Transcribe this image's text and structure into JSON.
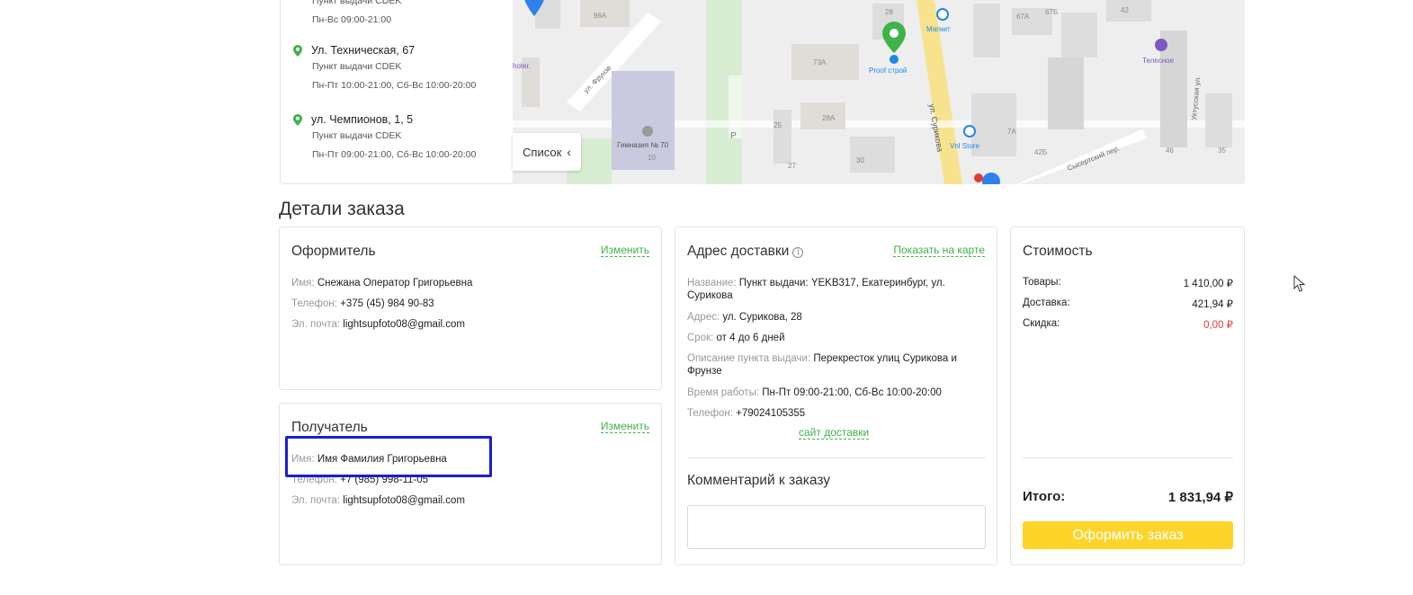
{
  "pickup_points": [
    {
      "address": "",
      "type": "Пункт выдачи CDEK",
      "hours": "Пн-Вс 09:00-21:00"
    },
    {
      "address": "Ул. Техническая, 67",
      "type": "Пункт выдачи CDEK",
      "hours": "Пн-Пт 10:00-21:00, Сб-Вс 10:00-20:00"
    },
    {
      "address": "ул. Чемпионов, 1, 5",
      "type": "Пункт выдачи CDEK",
      "hours": "Пн-Пт 09:00-21:00, Сб-Вс 10:00-20:00"
    }
  ],
  "map": {
    "list_toggle": "Список",
    "labels": {
      "b96a": "96А",
      "b73a": "73А",
      "b28a": "28А",
      "b25": "25",
      "b27": "27",
      "b30": "30",
      "b28": "28",
      "b67a": "67А",
      "b67b": "67Б",
      "b42": "42",
      "b46": "46",
      "b35": "35",
      "b42b": "42Б",
      "b7a": "7А",
      "b10": "10",
      "p": "P",
      "magnit": "Магнит",
      "proof": "Proof строй",
      "vnl": "Vnl Store",
      "telesnoe": "Телесное",
      "gymnasium": "Гимназия № 70",
      "frunze": "ул. Фрунзе",
      "surikova": "ул. Сурикова",
      "sysert": "Сысертский пер.",
      "ukhtus": "Уктусская ул.",
      "hoter": "hoter."
    }
  },
  "section_title": "Детали заказа",
  "orderer": {
    "title": "Оформитель",
    "change": "Изменить",
    "name_label": "Имя:",
    "name": "Снежана Оператор Григорьевна",
    "phone_label": "Телефон:",
    "phone": "+375 (45) 984 90-83",
    "email_label": "Эл. почта:",
    "email": "lightsupfoto08@gmail.com"
  },
  "recipient": {
    "title": "Получатель",
    "change": "Изменить",
    "name_label": "Имя:",
    "name": "Имя Фамилия Григорьевна",
    "phone_label": "Телефон:",
    "phone": "+7 (985) 998-11-05",
    "email_label": "Эл. почта:",
    "email": "lightsupfoto08@gmail.com"
  },
  "delivery": {
    "title": "Адрес доставки",
    "info_icon": "i",
    "show_on_map": "Показать на карте",
    "name_label": "Название:",
    "name": "Пункт выдачи: YEKB317, Екатеринбург, ул. Сурикова",
    "address_label": "Адрес:",
    "address": "ул. Сурикова, 28",
    "term_label": "Срок:",
    "term": "от 4 до 6 дней",
    "desc_label": "Описание пункта выдачи:",
    "desc": "Перекресток улиц Сурикова и Фрунзе",
    "hours_label": "Время работы:",
    "hours": "Пн-Пт 09:00-21:00, Сб-Вс 10:00-20:00",
    "phone_label": "Телефон:",
    "phone": "+79024105355",
    "site_link": "сайт доставки",
    "comment_title": "Комментарий к заказу",
    "comment_value": ""
  },
  "cost": {
    "title": "Стоимость",
    "goods_label": "Товары:",
    "goods": "1 410,00 ₽",
    "delivery_label": "Доставка:",
    "delivery": "421,94 ₽",
    "discount_label": "Скидка:",
    "discount": "0,00 ₽",
    "total_label": "Итого:",
    "total": "1 831,94 ₽",
    "order_button": "Оформить заказ"
  },
  "colors": {
    "accent_green": "#3fb24b",
    "button_yellow": "#fed42b",
    "discount_red": "#e53935",
    "highlight_blue": "#1c1ed1"
  }
}
